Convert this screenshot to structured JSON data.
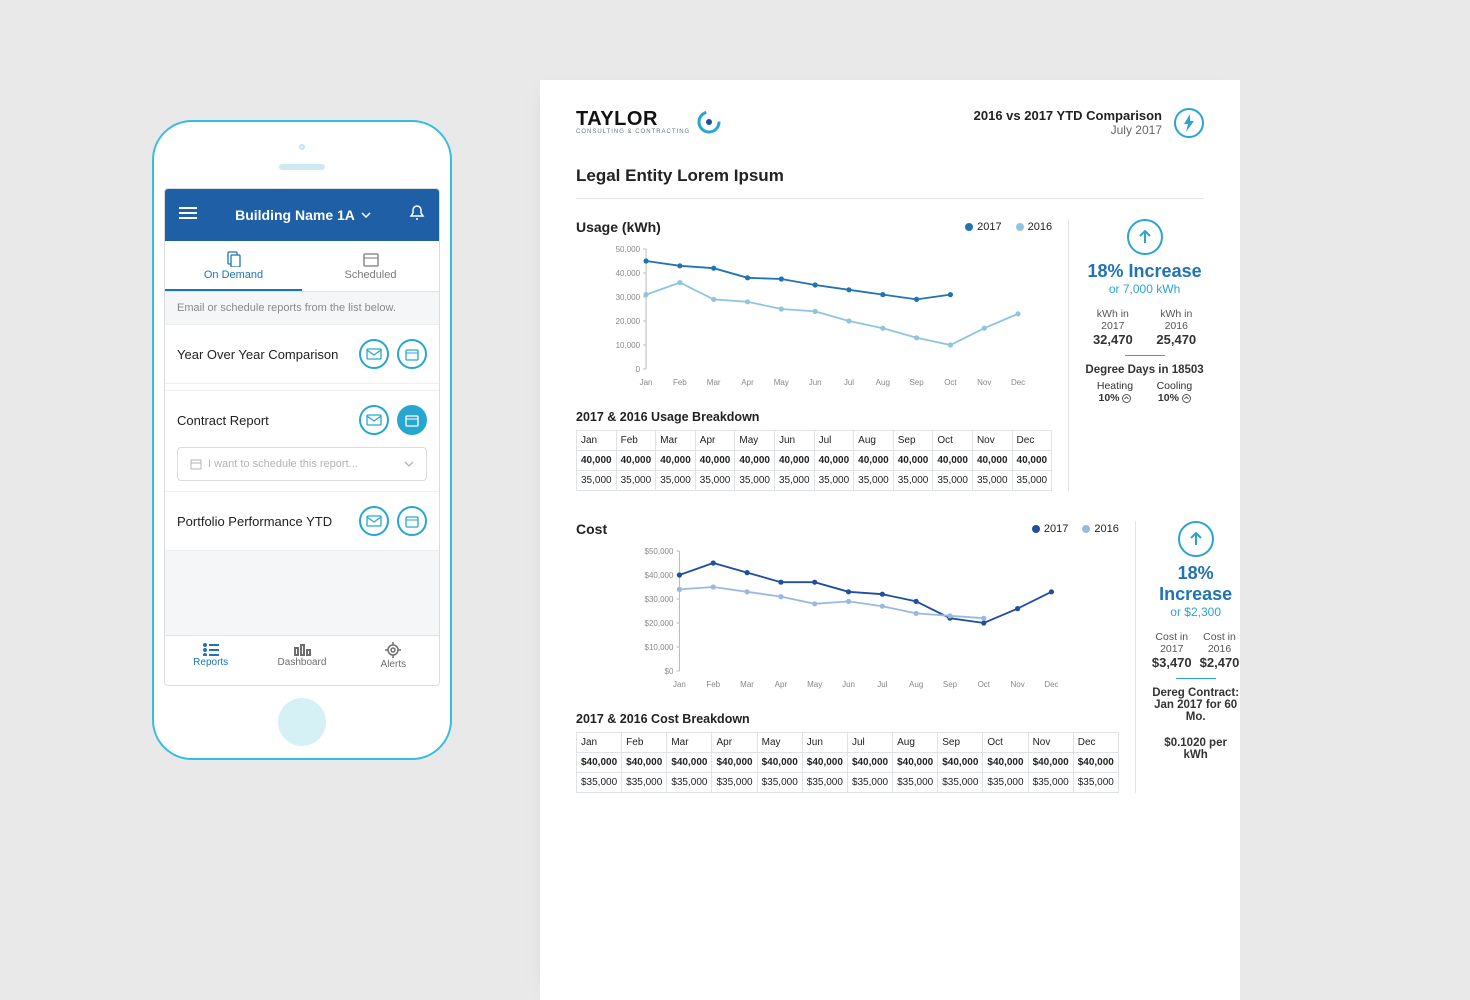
{
  "phone": {
    "title": "Building Name 1A",
    "tabs": {
      "on_demand": "On Demand",
      "scheduled": "Scheduled"
    },
    "helper": "Email or schedule reports from the list below.",
    "rows": [
      {
        "label": "Year Over Year Comparison"
      },
      {
        "label": "Contract Report"
      },
      {
        "label": "Portfolio Performance YTD"
      }
    ],
    "schedule_placeholder": "I want to schedule this report...",
    "nav": {
      "reports": "Reports",
      "dashboard": "Dashboard",
      "alerts": "Alerts"
    }
  },
  "report": {
    "brand": {
      "name": "TAYLOR",
      "sub": "CONSULTING & CONTRACTING"
    },
    "header": {
      "line1": "2016 vs 2017 YTD Comparison",
      "line2": "July 2017"
    },
    "entity": "Legal Entity Lorem Ipsum",
    "months": [
      "Jan",
      "Feb",
      "Mar",
      "Apr",
      "May",
      "Jun",
      "Jul",
      "Aug",
      "Sep",
      "Oct",
      "Nov",
      "Dec"
    ],
    "usage": {
      "title": "Usage (kWh)",
      "legend_a": "2017",
      "legend_b": "2016",
      "metric_main": "18% Increase",
      "metric_sub": "or 7,000 kWh",
      "pair": [
        {
          "lbl": "kWh in 2017",
          "val": "32,470"
        },
        {
          "lbl": "kWh in 2016",
          "val": "25,470"
        }
      ],
      "degree_days": "Degree Days in 18503",
      "heating": "10%",
      "cooling": "10%",
      "breakdown_title": "2017 & 2016 Usage Breakdown",
      "row1": [
        "40,000",
        "40,000",
        "40,000",
        "40,000",
        "40,000",
        "40,000",
        "40,000",
        "40,000",
        "40,000",
        "40,000",
        "40,000",
        "40,000"
      ],
      "row2": [
        "35,000",
        "35,000",
        "35,000",
        "35,000",
        "35,000",
        "35,000",
        "35,000",
        "35,000",
        "35,000",
        "35,000",
        "35,000",
        "35,000"
      ]
    },
    "cost": {
      "title": "Cost",
      "legend_a": "2017",
      "legend_b": "2016",
      "metric_main": "18% Increase",
      "metric_sub": "or $2,300",
      "pair": [
        {
          "lbl": "Cost in 2017",
          "val": "$3,470"
        },
        {
          "lbl": "Cost in 2016",
          "val": "$2,470"
        }
      ],
      "dereg": "Dereg Contract: Jan 2017 for 60 Mo.",
      "rate": "$0.1020 per kWh",
      "breakdown_title": "2017 & 2016 Cost Breakdown",
      "row1": [
        "$40,000",
        "$40,000",
        "$40,000",
        "$40,000",
        "$40,000",
        "$40,000",
        "$40,000",
        "$40,000",
        "$40,000",
        "$40,000",
        "$40,000",
        "$40,000"
      ],
      "row2": [
        "$35,000",
        "$35,000",
        "$35,000",
        "$35,000",
        "$35,000",
        "$35,000",
        "$35,000",
        "$35,000",
        "$35,000",
        "$35,000",
        "$35,000",
        "$35,000"
      ]
    }
  },
  "chart_data": [
    {
      "type": "line",
      "title": "Usage (kWh)",
      "xlabel": "",
      "ylabel": "",
      "ylim": [
        0,
        50000
      ],
      "y_ticks": [
        0,
        10000,
        20000,
        30000,
        40000,
        50000
      ],
      "y_tick_labels": [
        "0",
        "10,000",
        "20,000",
        "30,000",
        "40,000",
        "50,000"
      ],
      "categories": [
        "Jan",
        "Feb",
        "Mar",
        "Apr",
        "May",
        "Jun",
        "Jul",
        "Aug",
        "Sep",
        "Oct",
        "Nov",
        "Dec"
      ],
      "series": [
        {
          "name": "2017",
          "color": "#1f73b7",
          "values": [
            45000,
            43000,
            42000,
            38000,
            37500,
            35000,
            33000,
            31000,
            29000,
            31000,
            null,
            null
          ]
        },
        {
          "name": "2016",
          "color": "#8fc6dd",
          "values": [
            31000,
            36000,
            29000,
            28000,
            25000,
            24000,
            20000,
            17000,
            13000,
            10000,
            17000,
            23000
          ]
        }
      ]
    },
    {
      "type": "line",
      "title": "Cost",
      "xlabel": "",
      "ylabel": "",
      "ylim": [
        0,
        50000
      ],
      "y_ticks": [
        0,
        10000,
        20000,
        30000,
        40000,
        50000
      ],
      "y_tick_labels": [
        "$0",
        "$10,000",
        "$20,000",
        "$30,000",
        "$40,000",
        "$50,000"
      ],
      "categories": [
        "Jan",
        "Feb",
        "Mar",
        "Apr",
        "May",
        "Jun",
        "Jul",
        "Aug",
        "Sep",
        "Oct",
        "Nov",
        "Dec"
      ],
      "series": [
        {
          "name": "2017",
          "color": "#1f4f9e",
          "values": [
            40000,
            45000,
            41000,
            37000,
            37000,
            33000,
            32000,
            29000,
            22000,
            20000,
            26000,
            33000
          ]
        },
        {
          "name": "2016",
          "color": "#9bb9df",
          "values": [
            34000,
            35000,
            33000,
            31000,
            28000,
            29000,
            27000,
            24000,
            23000,
            22000,
            null,
            null
          ]
        }
      ]
    }
  ]
}
